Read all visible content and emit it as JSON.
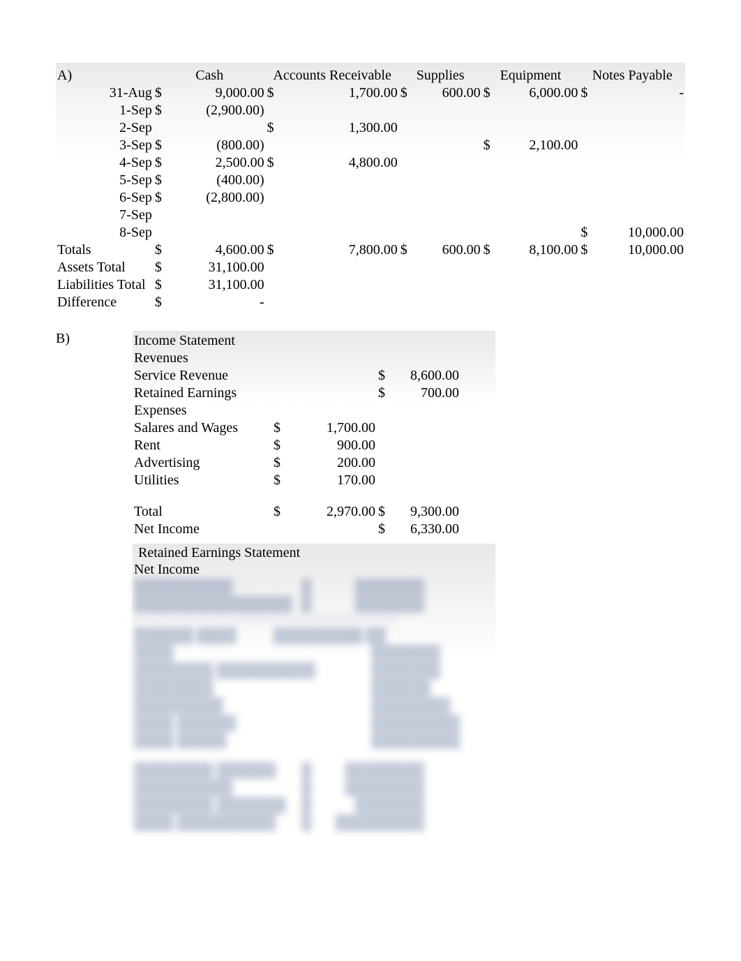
{
  "sectionA": {
    "label": "A)",
    "headers": {
      "cash": "Cash",
      "ar": "Accounts Receivable",
      "supplies": "Supplies",
      "equipment": "Equipment",
      "notes_payable": "Notes Payable"
    },
    "rows": [
      {
        "date": "31-Aug",
        "cash_d": "$",
        "cash": "9,000.00",
        "ar_d": "$",
        "ar": "1,700.00",
        "sup_d": "$",
        "sup": "600.00",
        "eq_d": "$",
        "eq": "6,000.00",
        "np_d": "$",
        "np": "-"
      },
      {
        "date": "1-Sep",
        "cash_d": "$",
        "cash": "(2,900.00)"
      },
      {
        "date": "2-Sep",
        "ar_d": "$",
        "ar": "1,300.00"
      },
      {
        "date": "3-Sep",
        "cash_d": "$",
        "cash": "(800.00)",
        "eq_d": "$",
        "eq": "2,100.00"
      },
      {
        "date": "4-Sep",
        "cash_d": "$",
        "cash": "2,500.00",
        "ar_d": "$",
        "ar": "4,800.00"
      },
      {
        "date": "5-Sep",
        "cash_d": "$",
        "cash": "(400.00)"
      },
      {
        "date": "6-Sep",
        "cash_d": "$",
        "cash": "(2,800.00)"
      },
      {
        "date": "7-Sep"
      },
      {
        "date": "8-Sep",
        "np_d": "$",
        "np": "10,000.00"
      }
    ],
    "totals": {
      "label": "Totals",
      "cash_d": "$",
      "cash": "4,600.00",
      "ar_d": "$",
      "ar": "7,800.00",
      "sup_d": "$",
      "sup": "600.00",
      "eq_d": "$",
      "eq": "8,100.00",
      "np_d": "$",
      "np": "10,000.00"
    },
    "assets_total": {
      "label": "Assets Total",
      "d": "$",
      "v": "31,100.00"
    },
    "liab_total": {
      "label": "Liabilities Total",
      "d": "$",
      "v": "31,100.00"
    },
    "difference": {
      "label": "Difference",
      "d": "$",
      "v": "-"
    }
  },
  "sectionB": {
    "label": "B)",
    "income_statement": {
      "title": "Income Statement",
      "revenues_label": "Revenues",
      "service_revenue": {
        "label": "Service Revenue",
        "d": "$",
        "v": "8,600.00"
      },
      "retained_earnings": {
        "label": "Retained Earnings",
        "d": "$",
        "v": "700.00"
      },
      "expenses_label": "Expenses",
      "expenses": [
        {
          "label": "Salares and Wages",
          "d": "$",
          "v": "1,700.00"
        },
        {
          "label": "Rent",
          "d": "$",
          "v": "900.00"
        },
        {
          "label": "Advertising",
          "d": "$",
          "v": "200.00"
        },
        {
          "label": "Utilities",
          "d": "$",
          "v": "170.00"
        }
      ],
      "total": {
        "label": "Total",
        "d": "$",
        "v": "2,970.00",
        "d2": "$",
        "v2": "9,300.00"
      },
      "net_income": {
        "label": "Net Income",
        "d": "$",
        "v": "6,330.00"
      }
    },
    "retained_earnings_statement": {
      "title": "Retained Earnings Statement",
      "net_income_label": "Net Income"
    }
  }
}
